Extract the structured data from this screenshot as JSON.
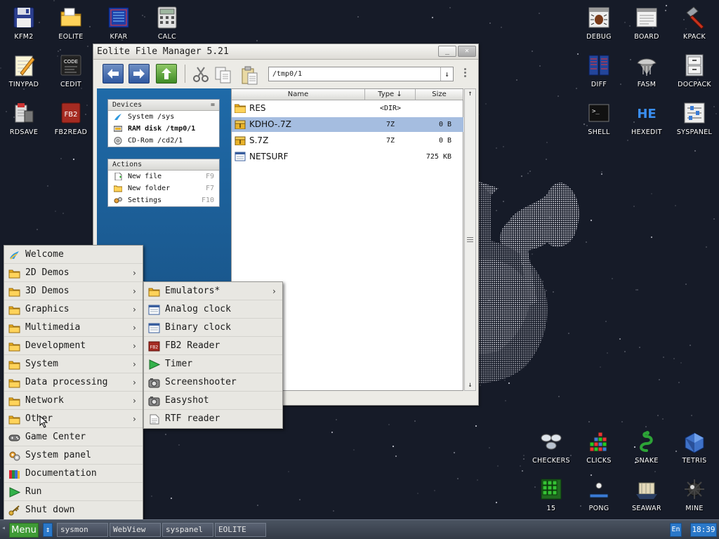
{
  "desktop_left": [
    {
      "label": "KFM2",
      "icon": "floppy-icon"
    },
    {
      "label": "EOLITE",
      "icon": "folder-icon"
    },
    {
      "label": "KFAR",
      "icon": "kfar-icon"
    },
    {
      "label": "CALC",
      "icon": "calculator-icon"
    },
    {
      "label": "TINYPAD",
      "icon": "notepad-icon"
    },
    {
      "label": "CEDIT",
      "icon": "code-icon"
    },
    {
      "label": "RDSAVE",
      "icon": "rdsave-icon"
    },
    {
      "label": "FB2READ",
      "icon": "fb2-icon"
    }
  ],
  "desktop_right": [
    {
      "label": "DEBUG",
      "icon": "debug-icon"
    },
    {
      "label": "BOARD",
      "icon": "board-icon"
    },
    {
      "label": "KPACK",
      "icon": "hammer-icon"
    },
    {
      "label": "DIFF",
      "icon": "diff-icon"
    },
    {
      "label": "FASM",
      "icon": "fasm-icon"
    },
    {
      "label": "DOCPACK",
      "icon": "cabinet-icon"
    },
    {
      "label": "SHELL",
      "icon": "terminal-icon"
    },
    {
      "label": "HEXEDIT",
      "icon": "hex-icon"
    },
    {
      "label": "SYSPANEL",
      "icon": "sliders-icon"
    }
  ],
  "desktop_games": [
    {
      "label": "CHECKERS",
      "icon": "checkers-icon"
    },
    {
      "label": "CLICKS",
      "icon": "clicks-icon"
    },
    {
      "label": "SNAKE",
      "icon": "snake-icon"
    },
    {
      "label": "TETRIS",
      "icon": "tetris-icon"
    },
    {
      "label": "15",
      "icon": "fifteen-icon"
    },
    {
      "label": "PONG",
      "icon": "pong-icon"
    },
    {
      "label": "SEAWAR",
      "icon": "ship-icon"
    },
    {
      "label": "MINE",
      "icon": "mine-icon"
    }
  ],
  "window": {
    "title": "Eolite File Manager 5.21",
    "minimize_label": "_",
    "close_label": "✕",
    "path": "/tmp0/1",
    "devices": {
      "header": "Devices",
      "header_mark": "=",
      "items": [
        {
          "label": "System /sys",
          "bold": false
        },
        {
          "label": "RAM disk /tmp0/1",
          "bold": true
        },
        {
          "label": "CD-Rom /cd2/1",
          "bold": false
        }
      ]
    },
    "actions": {
      "header": "Actions",
      "items": [
        {
          "label": "New file",
          "key": "F9"
        },
        {
          "label": "New folder",
          "key": "F7"
        },
        {
          "label": "Settings",
          "key": "F10"
        }
      ]
    },
    "columns": {
      "name": "Name",
      "type": "Type ↓",
      "size": "Size",
      "up": "↑"
    },
    "files": [
      {
        "name": "RES",
        "type": "<DIR>",
        "size": "",
        "kind": "folder",
        "selected": false
      },
      {
        "name": "KDHO-.7Z",
        "type": "7Z",
        "size": "0 B",
        "kind": "archive",
        "selected": true
      },
      {
        "name": "S.7Z",
        "type": "7Z",
        "size": "0 B",
        "kind": "archive",
        "selected": false
      },
      {
        "name": "NETSURF",
        "type": "",
        "size": "725 KB",
        "kind": "app",
        "selected": false
      }
    ],
    "scroll_up": "↑",
    "scroll_down": "↓"
  },
  "start_menu": {
    "items": [
      {
        "label": "Welcome",
        "icon": "welcome-icon",
        "submenu": false
      },
      {
        "label": "2D Demos",
        "icon": "folder-icon",
        "submenu": true
      },
      {
        "label": "3D Demos",
        "icon": "folder-icon",
        "submenu": true
      },
      {
        "label": "Graphics",
        "icon": "folder-icon",
        "submenu": true
      },
      {
        "label": "Multimedia",
        "icon": "folder-icon",
        "submenu": true
      },
      {
        "label": "Development",
        "icon": "folder-icon",
        "submenu": true
      },
      {
        "label": "System",
        "icon": "folder-icon",
        "submenu": true
      },
      {
        "label": "Data processing",
        "icon": "folder-icon",
        "submenu": true
      },
      {
        "label": "Network",
        "icon": "folder-icon",
        "submenu": true
      },
      {
        "label": "Other",
        "icon": "folder-icon",
        "submenu": true
      },
      {
        "label": "Game Center",
        "icon": "gamepad-icon",
        "submenu": false
      },
      {
        "label": "System panel",
        "icon": "gears-icon",
        "submenu": false
      },
      {
        "label": "Documentation",
        "icon": "books-icon",
        "submenu": false
      },
      {
        "label": "Run",
        "icon": "play-icon",
        "submenu": false
      },
      {
        "label": "Shut down",
        "icon": "key-icon",
        "submenu": false
      }
    ],
    "chevron": "›"
  },
  "submenu": {
    "items": [
      {
        "label": "Emulators*",
        "icon": "folder-icon",
        "submenu": true
      },
      {
        "label": "Analog clock",
        "icon": "window-icon",
        "submenu": false
      },
      {
        "label": "Binary clock",
        "icon": "window-icon",
        "submenu": false
      },
      {
        "label": "FB2 Reader",
        "icon": "fb2-icon",
        "submenu": false
      },
      {
        "label": "Timer",
        "icon": "play-icon",
        "submenu": false
      },
      {
        "label": "Screenshooter",
        "icon": "camera-icon",
        "submenu": false
      },
      {
        "label": "Easyshot",
        "icon": "camera-icon",
        "submenu": false
      },
      {
        "label": "RTF reader",
        "icon": "document-icon",
        "submenu": false
      }
    ]
  },
  "taskbar": {
    "menu_label": "Menu",
    "swap_label": "↕",
    "tasks": [
      "sysmon",
      "WebView",
      "syspanel",
      "EOLITE"
    ],
    "lang": "En",
    "time": "18:39",
    "left_arrow": "◂"
  }
}
